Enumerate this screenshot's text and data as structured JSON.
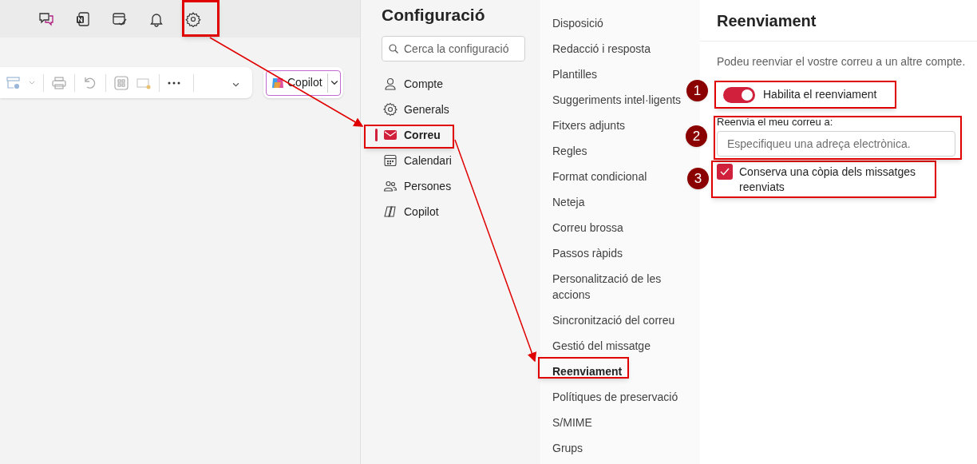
{
  "toolbar": {
    "copilot_button": "Copilot"
  },
  "settings": {
    "title": "Configuració",
    "search": {
      "placeholder": "Cerca la configuració"
    },
    "nav": [
      {
        "label": "Compte",
        "selected": false
      },
      {
        "label": "Generals",
        "selected": false
      },
      {
        "label": "Correu",
        "selected": true
      },
      {
        "label": "Calendari",
        "selected": false
      },
      {
        "label": "Persones",
        "selected": false
      },
      {
        "label": "Copilot",
        "selected": false
      }
    ]
  },
  "categories": [
    {
      "label": "Disposició",
      "selected": false
    },
    {
      "label": "Redacció i resposta",
      "selected": false
    },
    {
      "label": "Plantilles",
      "selected": false
    },
    {
      "label": "Suggeriments intel·ligents",
      "selected": false
    },
    {
      "label": "Fitxers adjunts",
      "selected": false
    },
    {
      "label": "Regles",
      "selected": false
    },
    {
      "label": "Format condicional",
      "selected": false
    },
    {
      "label": "Neteja",
      "selected": false
    },
    {
      "label": "Correu brossa",
      "selected": false
    },
    {
      "label": "Passos ràpids",
      "selected": false
    },
    {
      "label": "Personalització de les accions",
      "selected": false
    },
    {
      "label": "Sincronització del correu",
      "selected": false
    },
    {
      "label": "Gestió del missatge",
      "selected": false
    },
    {
      "label": "Reenviament",
      "selected": true
    },
    {
      "label": "Polítiques de preservació",
      "selected": false
    },
    {
      "label": "S/MIME",
      "selected": false
    },
    {
      "label": "Grups",
      "selected": false
    }
  ],
  "panel": {
    "title": "Reenviament",
    "description": "Podeu reenviar el vostre correu a un altre compte.",
    "forwarding_toggle": {
      "label": "Habilita el reenviament",
      "on": true
    },
    "forward_to": {
      "label": "Reenvia el meu correu a:",
      "placeholder": "Especifiqueu una adreça electrònica."
    },
    "keep_copy": {
      "label": "Conserva una còpia dels missatges reenviats",
      "checked": true
    }
  },
  "annotation_markers": [
    "1",
    "2",
    "3"
  ]
}
